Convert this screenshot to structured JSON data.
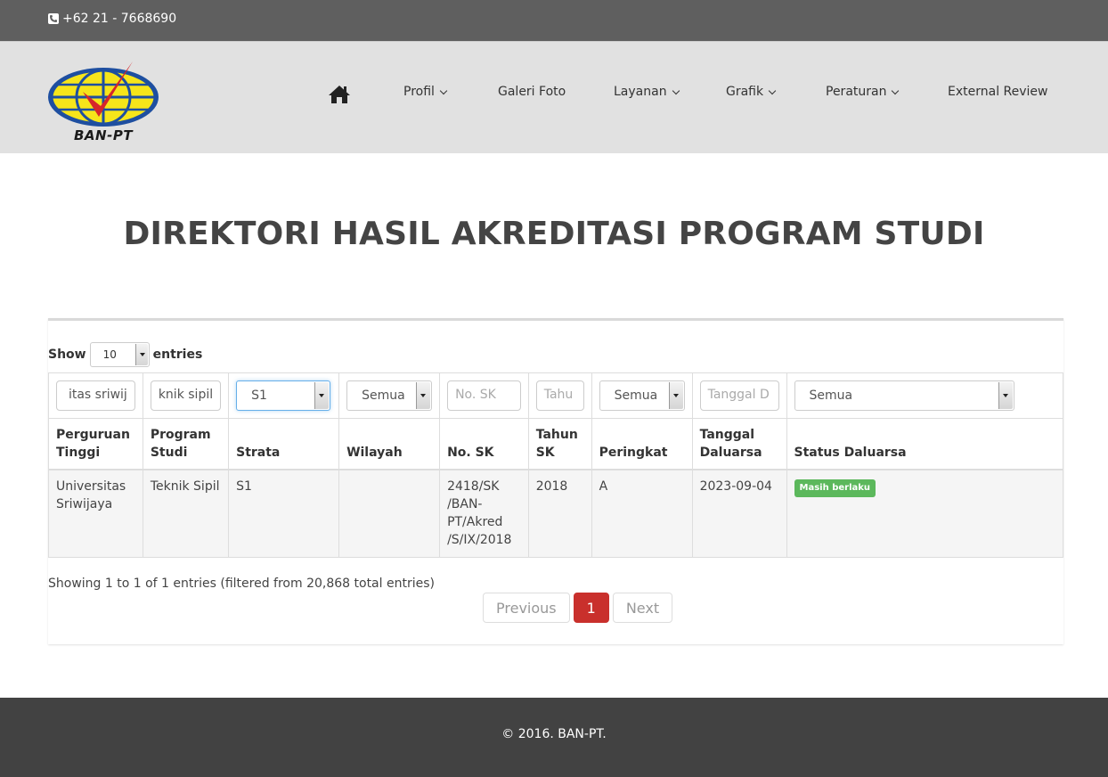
{
  "topbar": {
    "phone": "+62 21 - 7668690"
  },
  "logo": {
    "text": "BAN-PT"
  },
  "nav": {
    "items": [
      {
        "label": "Profil",
        "dropdown": true
      },
      {
        "label": "Galeri Foto",
        "dropdown": false
      },
      {
        "label": "Layanan",
        "dropdown": true
      },
      {
        "label": "Grafik",
        "dropdown": true
      },
      {
        "label": "Peraturan",
        "dropdown": true
      },
      {
        "label": "External Review",
        "dropdown": false
      }
    ]
  },
  "page": {
    "title": "DIREKTORI HASIL AKREDITASI PROGRAM STUDI"
  },
  "table_controls": {
    "show_label": "Show",
    "entries_label": "entries",
    "page_length": "10"
  },
  "filters": {
    "perguruan_tinggi": "itas sriwij",
    "program_studi": "knik sipil",
    "strata": "S1",
    "wilayah": "Semua",
    "no_sk_placeholder": "No. SK",
    "tahun_sk_placeholder": "Tahu",
    "peringkat": "Semua",
    "tanggal_placeholder": "Tanggal D",
    "status": "Semua"
  },
  "columns": {
    "perguruan_tinggi": [
      "Perguruan",
      "Tinggi"
    ],
    "program_studi": [
      "Program",
      "Studi"
    ],
    "strata": "Strata",
    "wilayah": "Wilayah",
    "no_sk": "No. SK",
    "tahun_sk": [
      "Tahun",
      "SK"
    ],
    "peringkat": "Peringkat",
    "tanggal_daluarsa": [
      "Tanggal",
      "Daluarsa"
    ],
    "status_daluarsa": "Status Daluarsa"
  },
  "rows": [
    {
      "perguruan_tinggi": [
        "Universitas",
        "Sriwijaya"
      ],
      "program_studi": "Teknik Sipil",
      "strata": "S1",
      "wilayah": "",
      "no_sk": [
        "2418/SK",
        "/BAN-",
        "PT/Akred",
        "/S/IX/2018"
      ],
      "tahun_sk": "2018",
      "peringkat": "A",
      "tanggal_daluarsa": "2023-09-04",
      "status_daluarsa": "Masih berlaku",
      "status_color": "#5cb85c"
    }
  ],
  "info": "Showing 1 to 1 of 1 entries (filtered from 20,868 total entries)",
  "pagination": {
    "previous": "Previous",
    "current": "1",
    "next": "Next"
  },
  "footer": {
    "text": "© 2016. BAN-PT."
  }
}
